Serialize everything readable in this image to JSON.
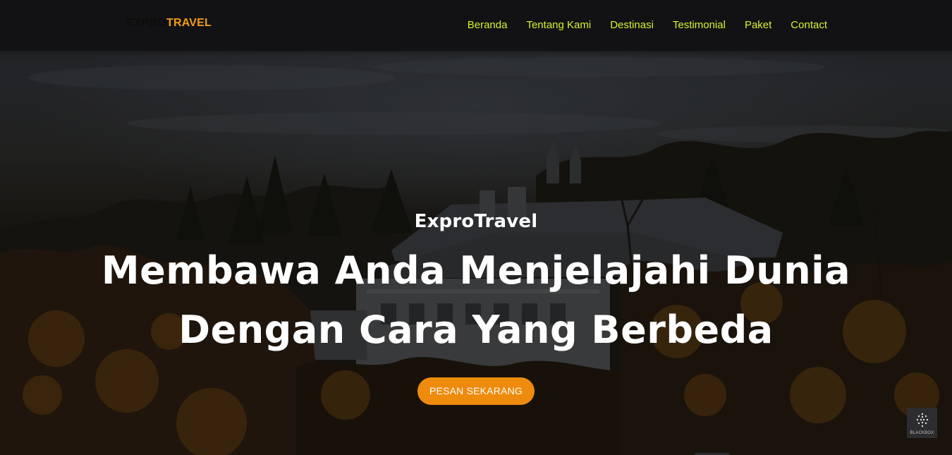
{
  "navbar": {
    "brand_part1": "EXPRO",
    "brand_part2": "TRAVEL",
    "links": [
      "Beranda",
      "Tentang Kami",
      "Destinasi",
      "Testimonial",
      "Paket",
      "Contact"
    ]
  },
  "hero": {
    "subtitle": "ExproTravel",
    "title": "Membawa Anda Menjelajahi Dunia Dengan Cara Yang Berbeda",
    "cta_label": "PESAN SEKARANG"
  },
  "widget": {
    "label": "BLACKBOX",
    "icon": "blackbox-logo-icon"
  },
  "colors": {
    "brand_accent": "#f39c12",
    "nav_link": "#d8f12a",
    "cta_background": "#ee8a0c",
    "navbar_background": "#111113"
  }
}
